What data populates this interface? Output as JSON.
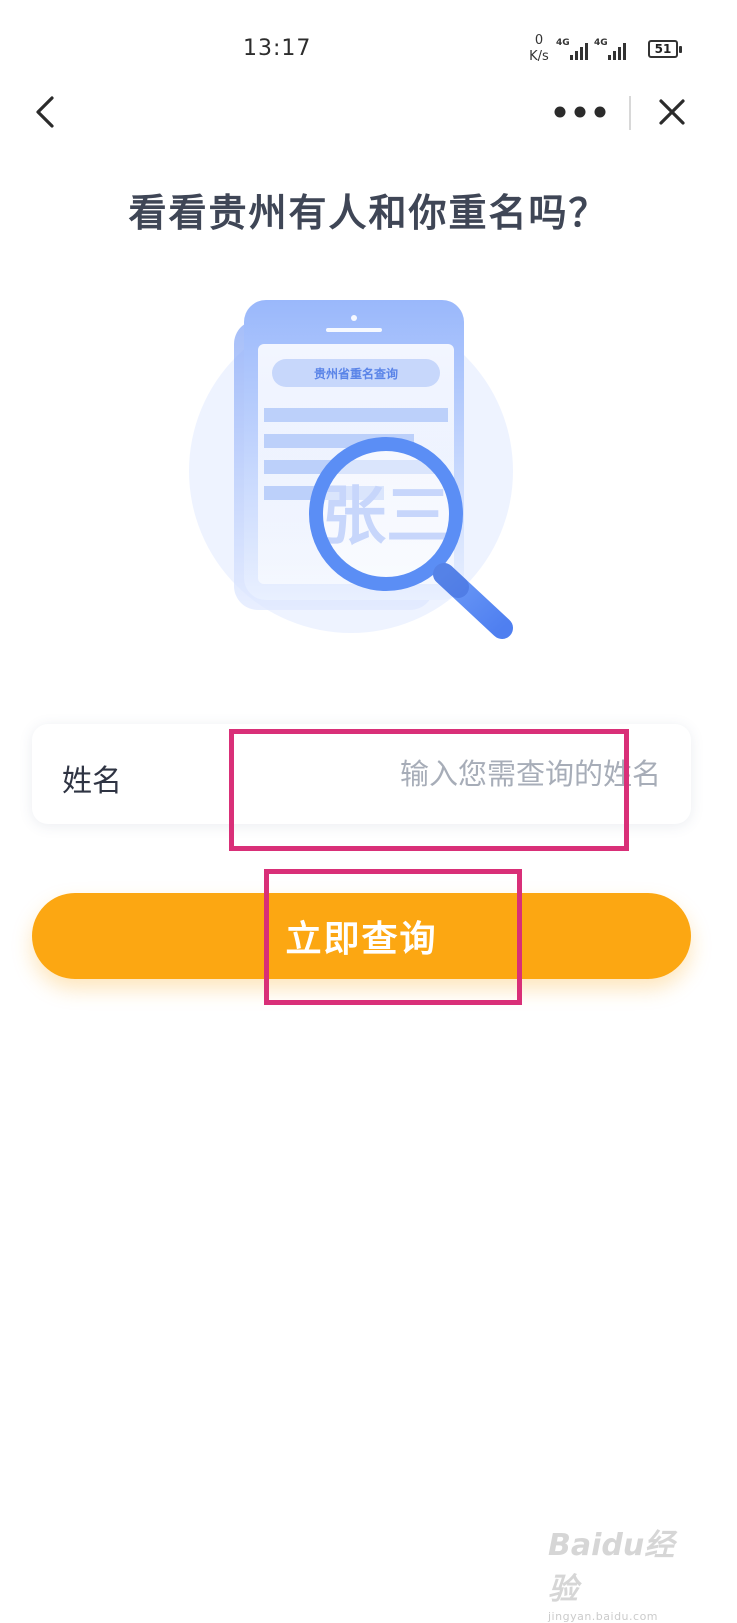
{
  "status_bar": {
    "time": "13:17",
    "net_speed_value": "0",
    "net_speed_unit": "K/s",
    "network_1": "4G",
    "network_2": "4G",
    "battery": "51"
  },
  "nav": {
    "back_icon": "chevron-left-icon",
    "more_icon": "more-dots-icon",
    "close_icon": "close-icon"
  },
  "page": {
    "title": "看看贵州有人和你重名吗？"
  },
  "illustration": {
    "banner_text": "贵州省重名查询",
    "sample_name": "张三"
  },
  "form": {
    "name_label": "姓名",
    "name_placeholder": "输入您需查询的姓名",
    "name_value": "",
    "submit_label": "立即查询"
  },
  "watermark": {
    "logo": "Baidu经验",
    "url": "jingyan.baidu.com"
  },
  "colors": {
    "accent": "#fca712",
    "highlight": "#d92f78",
    "title_text": "#3f4656",
    "illustration_blue": "#5b8ef5"
  }
}
